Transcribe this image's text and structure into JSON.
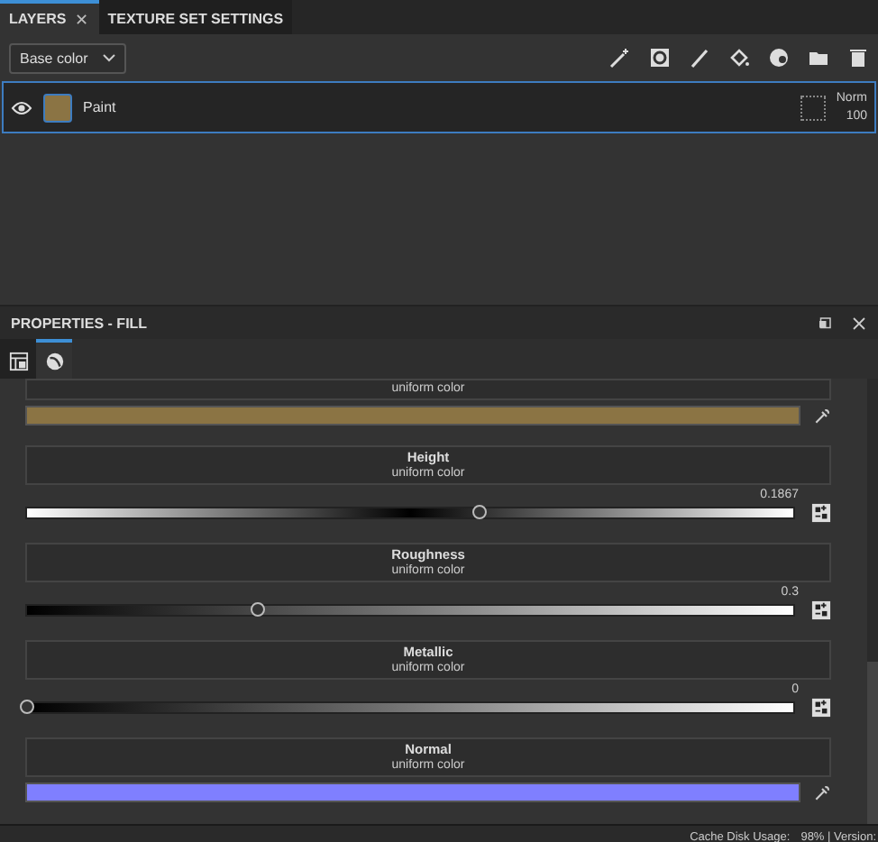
{
  "layers_panel": {
    "tabs": [
      {
        "label": "LAYERS",
        "selected": true,
        "close": "✕"
      },
      {
        "label": "TEXTURE SET SETTINGS",
        "selected": false
      }
    ],
    "channel_dropdown": "Base color",
    "layers": [
      {
        "name": "Paint",
        "visible": true,
        "selected": true,
        "color": "#8b7444",
        "blend": "Norm",
        "opacity": "100"
      }
    ]
  },
  "properties_panel": {
    "title": "PROPERTIES - FILL",
    "tabs": [
      {
        "selected": false
      },
      {
        "selected": true
      }
    ],
    "channels": [
      {
        "kind": "color",
        "subtitle": "uniform color",
        "color": "#8b7444"
      },
      {
        "kind": "signed-slider",
        "title": "Height",
        "subtitle": "uniform color",
        "value": "0.1867",
        "level": 0.59
      },
      {
        "kind": "slider",
        "title": "Roughness",
        "subtitle": "uniform color",
        "value": "0.3",
        "level": 0.3
      },
      {
        "kind": "slider",
        "title": "Metallic",
        "subtitle": "uniform color",
        "value": "0",
        "level": 0
      },
      {
        "kind": "color",
        "title": "Normal",
        "subtitle": "uniform color",
        "color": "#7f7fff"
      }
    ]
  },
  "status_bar": {
    "label": "Cache Disk Usage:",
    "value": "98% | Version:"
  }
}
